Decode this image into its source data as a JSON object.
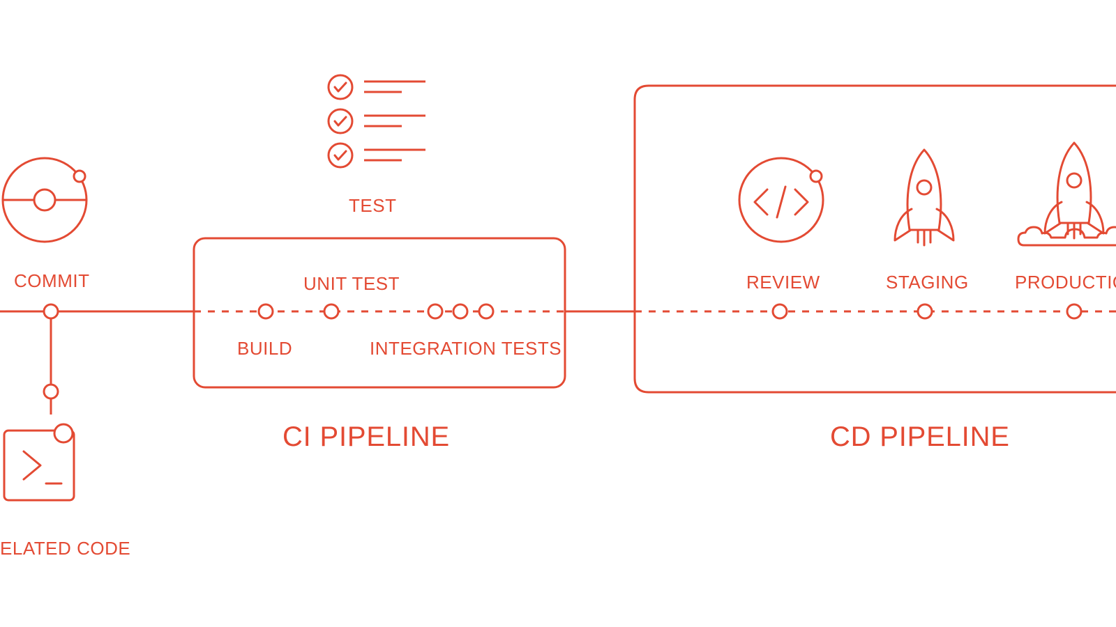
{
  "color": "#e34a33",
  "labels": {
    "commit": "COMMIT",
    "related_code": "ELATED CODE",
    "test": "TEST",
    "build": "BUILD",
    "unit_test": "UNIT TEST",
    "integration_tests": "INTEGRATION TESTS",
    "review": "REVIEW",
    "staging": "STAGING",
    "production": "PRODUCTIO",
    "ci_pipeline": "CI PIPELINE",
    "cd_pipeline": "CD PIPELINE"
  }
}
